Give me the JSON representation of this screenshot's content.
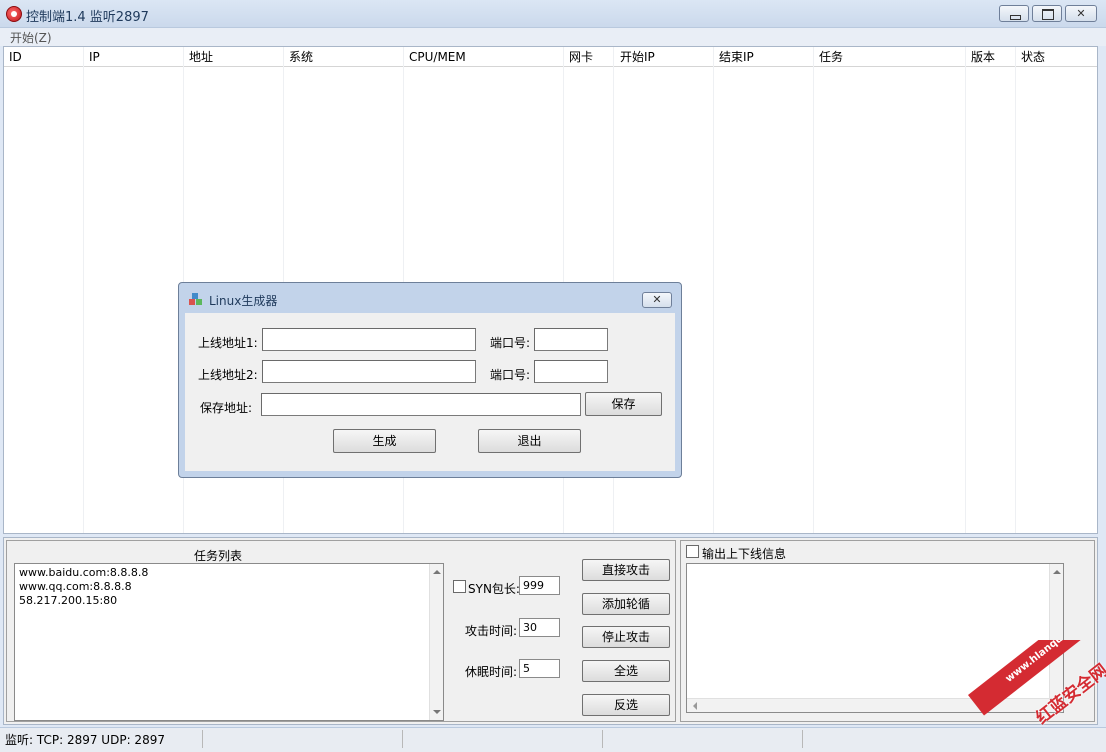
{
  "window": {
    "title": "控制端1.4 监听2897",
    "min_glyph": "",
    "close_glyph": "✕"
  },
  "menu": {
    "start": "开始(Z)"
  },
  "listview": {
    "columns": [
      "ID",
      "IP",
      "地址",
      "系统",
      "CPU/MEM",
      "网卡",
      "开始IP",
      "结束IP",
      "任务",
      "版本",
      "状态"
    ]
  },
  "dialog": {
    "title": "Linux生成器",
    "close_glyph": "✕",
    "online_addr1_label": "上线地址1:",
    "online_addr2_label": "上线地址2:",
    "port1_label": "端口号:",
    "port2_label": "端口号:",
    "save_path_label": "保存地址:",
    "save_button": "保存",
    "generate_button": "生成",
    "exit_button": "退出"
  },
  "tasks": {
    "header": "任务列表",
    "items": [
      "www.baidu.com:8.8.8.8",
      "www.qq.com:8.8.8.8",
      "58.217.200.15:80"
    ]
  },
  "attack": {
    "syn_label": "SYN包长:",
    "syn_value": "999",
    "attack_time_label": "攻击时间:",
    "attack_time_value": "30",
    "sleep_time_label": "休眠时间:",
    "sleep_time_value": "5",
    "buttons": [
      "直接攻击",
      "添加轮循",
      "停止攻击",
      "全选",
      "反选"
    ]
  },
  "log": {
    "checkbox_label": "输出上下线信息"
  },
  "status": {
    "text": "监听: TCP: 2897 UDP: 2897"
  },
  "watermark": {
    "text": "红蓝安全网",
    "url": "www.hlanquan.com"
  }
}
